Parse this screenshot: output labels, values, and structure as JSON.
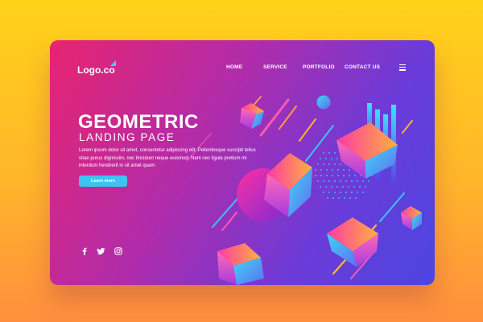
{
  "brand": {
    "logo": "Logo.co"
  },
  "nav": {
    "items": [
      "HOME",
      "SERVICE",
      "PORTFOLIO",
      "CONTACT US"
    ]
  },
  "hero": {
    "title": "GEOMETRIC",
    "subtitle": "LANDING PAGE",
    "body": "Lorem ipsum dolor sit amet, consectetur adipiscing elit. Pellentesque suscipit tellus vitae purus dignissim, nec tincidunt neque euismod. Nam nec ligula pretium mi interdum hendrerit in sit amet quam.",
    "button_label": "Learn more"
  },
  "social": {
    "icons": [
      "facebook-icon",
      "twitter-icon",
      "instagram-icon"
    ]
  },
  "colors": {
    "background_top": "#ffd21a",
    "background_bottom": "#ff8f3e",
    "card_left": "#e8246f",
    "card_right": "#4b46e0",
    "accent_button": "#3ec3f0"
  }
}
